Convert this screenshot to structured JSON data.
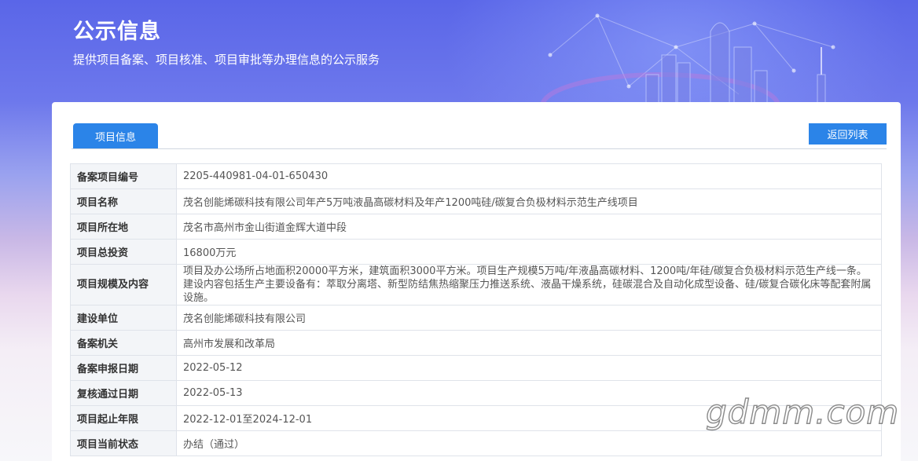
{
  "header": {
    "title": "公示信息",
    "subtitle": "提供项目备案、项目核准、项目审批等办理信息的公示服务"
  },
  "tabs": [
    {
      "label": "项目信息",
      "active": true
    }
  ],
  "back_button_label": "返回列表",
  "rows": [
    {
      "label": "备案项目编号",
      "value": "2205-440981-04-01-650430"
    },
    {
      "label": "项目名称",
      "value": "茂名创能烯碳科技有限公司年产5万吨液晶高碳材料及年产1200吨硅/碳复合负极材料示范生产线项目"
    },
    {
      "label": "项目所在地",
      "value": "茂名市高州市金山街道金辉大道中段"
    },
    {
      "label": "项目总投资",
      "value": "16800万元"
    },
    {
      "label": "项目规模及内容",
      "value": "项目及办公场所占地面积20000平方米，建筑面积3000平方米。项目生产规模5万吨/年液晶高碳材料、1200吨/年硅/碳复合负极材料示范生产线一条。建设内容包括生产主要设备有：萃取分离塔、新型防结焦热缩聚压力推送系统、液晶干燥系统，硅碳混合及自动化成型设备、硅/碳复合碳化床等配套附属设施。"
    },
    {
      "label": "建设单位",
      "value": "茂名创能烯碳科技有限公司"
    },
    {
      "label": "备案机关",
      "value": "高州市发展和改革局"
    },
    {
      "label": "备案申报日期",
      "value": "2022-05-12"
    },
    {
      "label": "复核通过日期",
      "value": "2022-05-13"
    },
    {
      "label": "项目起止年限",
      "value": "2022-12-01至2024-12-01"
    },
    {
      "label": "项目当前状态",
      "value": "办结（通过）"
    }
  ],
  "watermark": "gdmm.com",
  "colors": {
    "accent": "#2b84e8",
    "label_bg": "#f3f5f8",
    "border": "#dfe3ea"
  }
}
